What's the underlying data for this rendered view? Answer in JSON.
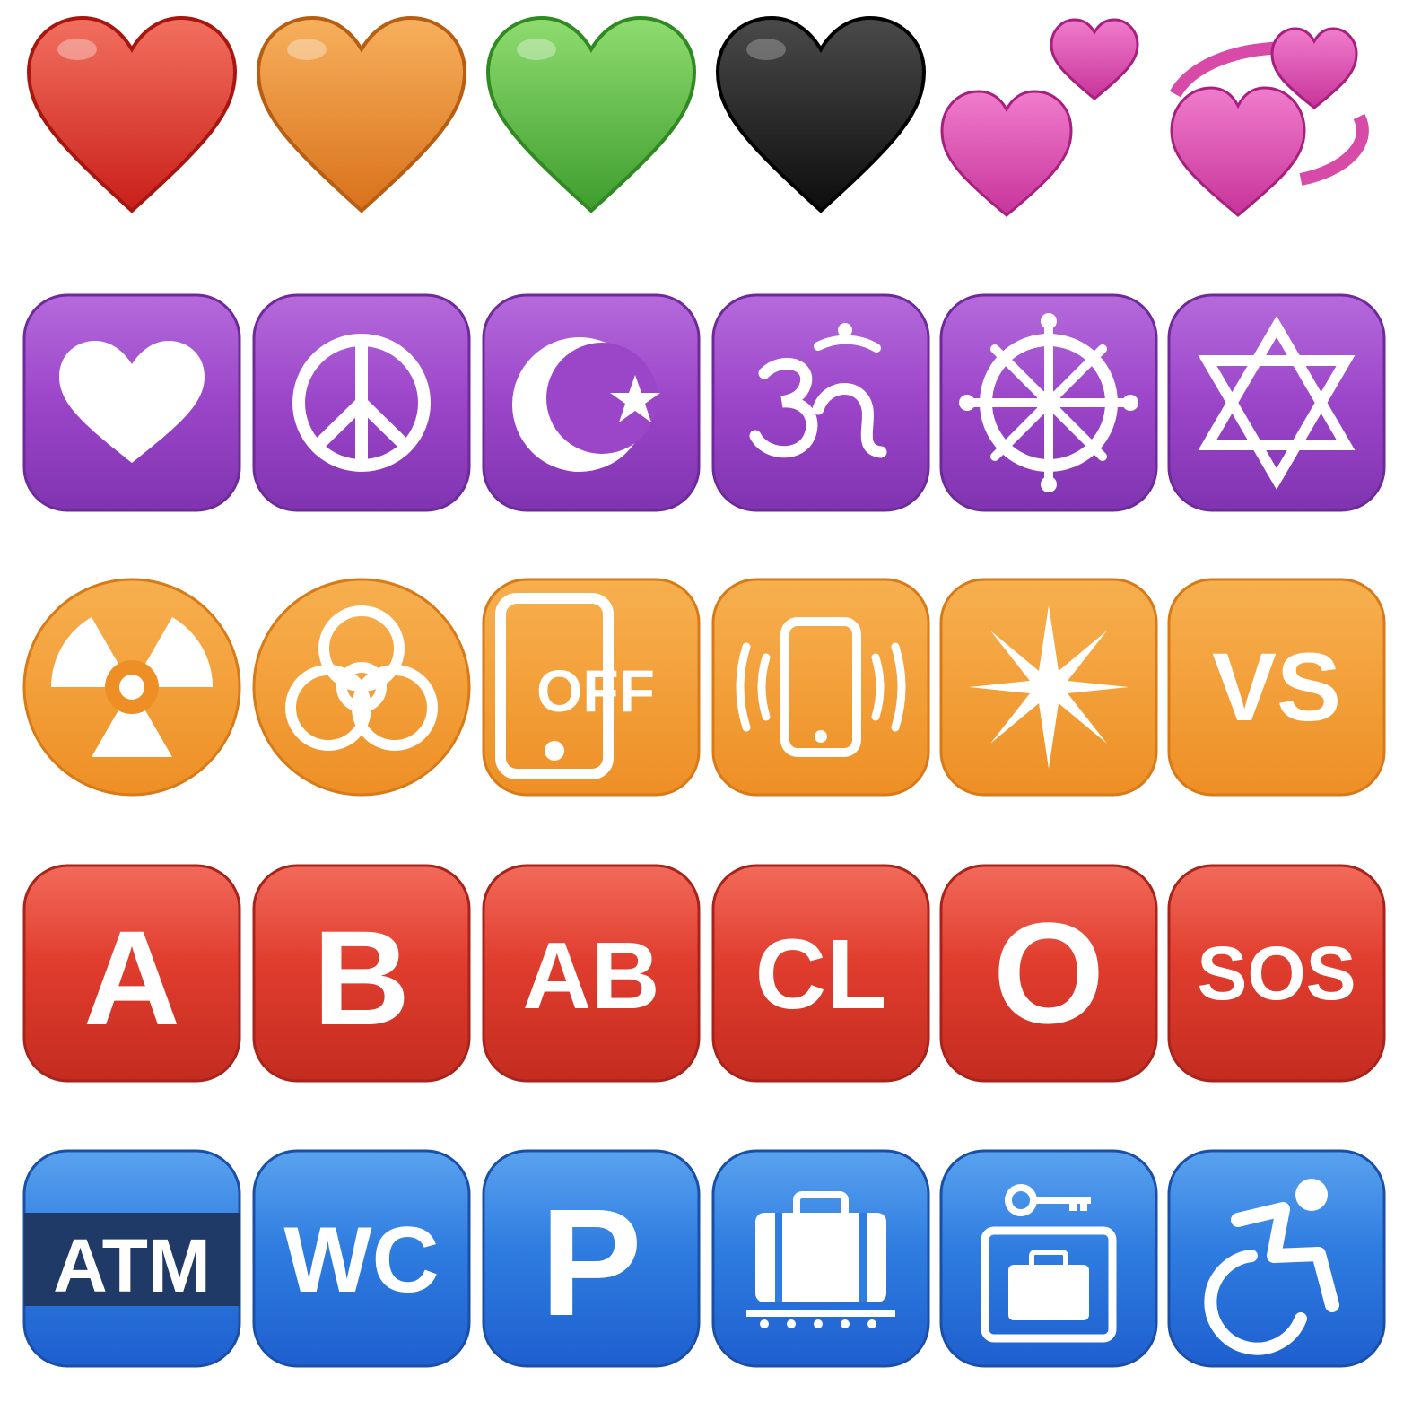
{
  "colors": {
    "purple": "#9b45c9",
    "orange": "#f39a2e",
    "red": "#dc3a2c",
    "blue": "#2f7de0",
    "atm_band": "#1f3a66",
    "heart_red": "#e5312c",
    "heart_orange": "#ef8c2e",
    "heart_green": "#62c24d",
    "heart_black": "#1a1a1a",
    "heart_pink": "#e04fb2"
  },
  "rows": [
    {
      "row": "hearts",
      "items": [
        {
          "name": "red-heart-icon"
        },
        {
          "name": "orange-heart-icon"
        },
        {
          "name": "green-heart-icon"
        },
        {
          "name": "black-heart-icon"
        },
        {
          "name": "two-hearts-icon"
        },
        {
          "name": "revolving-hearts-icon"
        }
      ]
    },
    {
      "row": "purple-symbols",
      "items": [
        {
          "name": "heart-decoration-icon"
        },
        {
          "name": "peace-symbol-icon"
        },
        {
          "name": "star-and-crescent-icon"
        },
        {
          "name": "om-icon"
        },
        {
          "name": "wheel-of-dharma-icon"
        },
        {
          "name": "star-of-david-icon"
        }
      ]
    },
    {
      "row": "orange-symbols",
      "items": [
        {
          "name": "radioactive-icon"
        },
        {
          "name": "biohazard-icon"
        },
        {
          "name": "mobile-phone-off-icon",
          "label": "OFF"
        },
        {
          "name": "vibration-mode-icon"
        },
        {
          "name": "eight-pointed-star-icon"
        },
        {
          "name": "vs-button-icon",
          "label": "VS"
        }
      ]
    },
    {
      "row": "red-buttons",
      "items": [
        {
          "name": "a-button-icon",
          "label": "A"
        },
        {
          "name": "b-button-icon",
          "label": "B"
        },
        {
          "name": "ab-button-icon",
          "label": "AB"
        },
        {
          "name": "cl-button-icon",
          "label": "CL"
        },
        {
          "name": "o-button-icon",
          "label": "O"
        },
        {
          "name": "sos-button-icon",
          "label": "SOS"
        }
      ]
    },
    {
      "row": "blue-buttons",
      "items": [
        {
          "name": "atm-sign-icon",
          "label": "ATM"
        },
        {
          "name": "water-closet-icon",
          "label": "WC"
        },
        {
          "name": "p-button-icon",
          "label": "P"
        },
        {
          "name": "baggage-claim-icon"
        },
        {
          "name": "left-luggage-icon"
        },
        {
          "name": "wheelchair-symbol-icon"
        }
      ]
    }
  ]
}
